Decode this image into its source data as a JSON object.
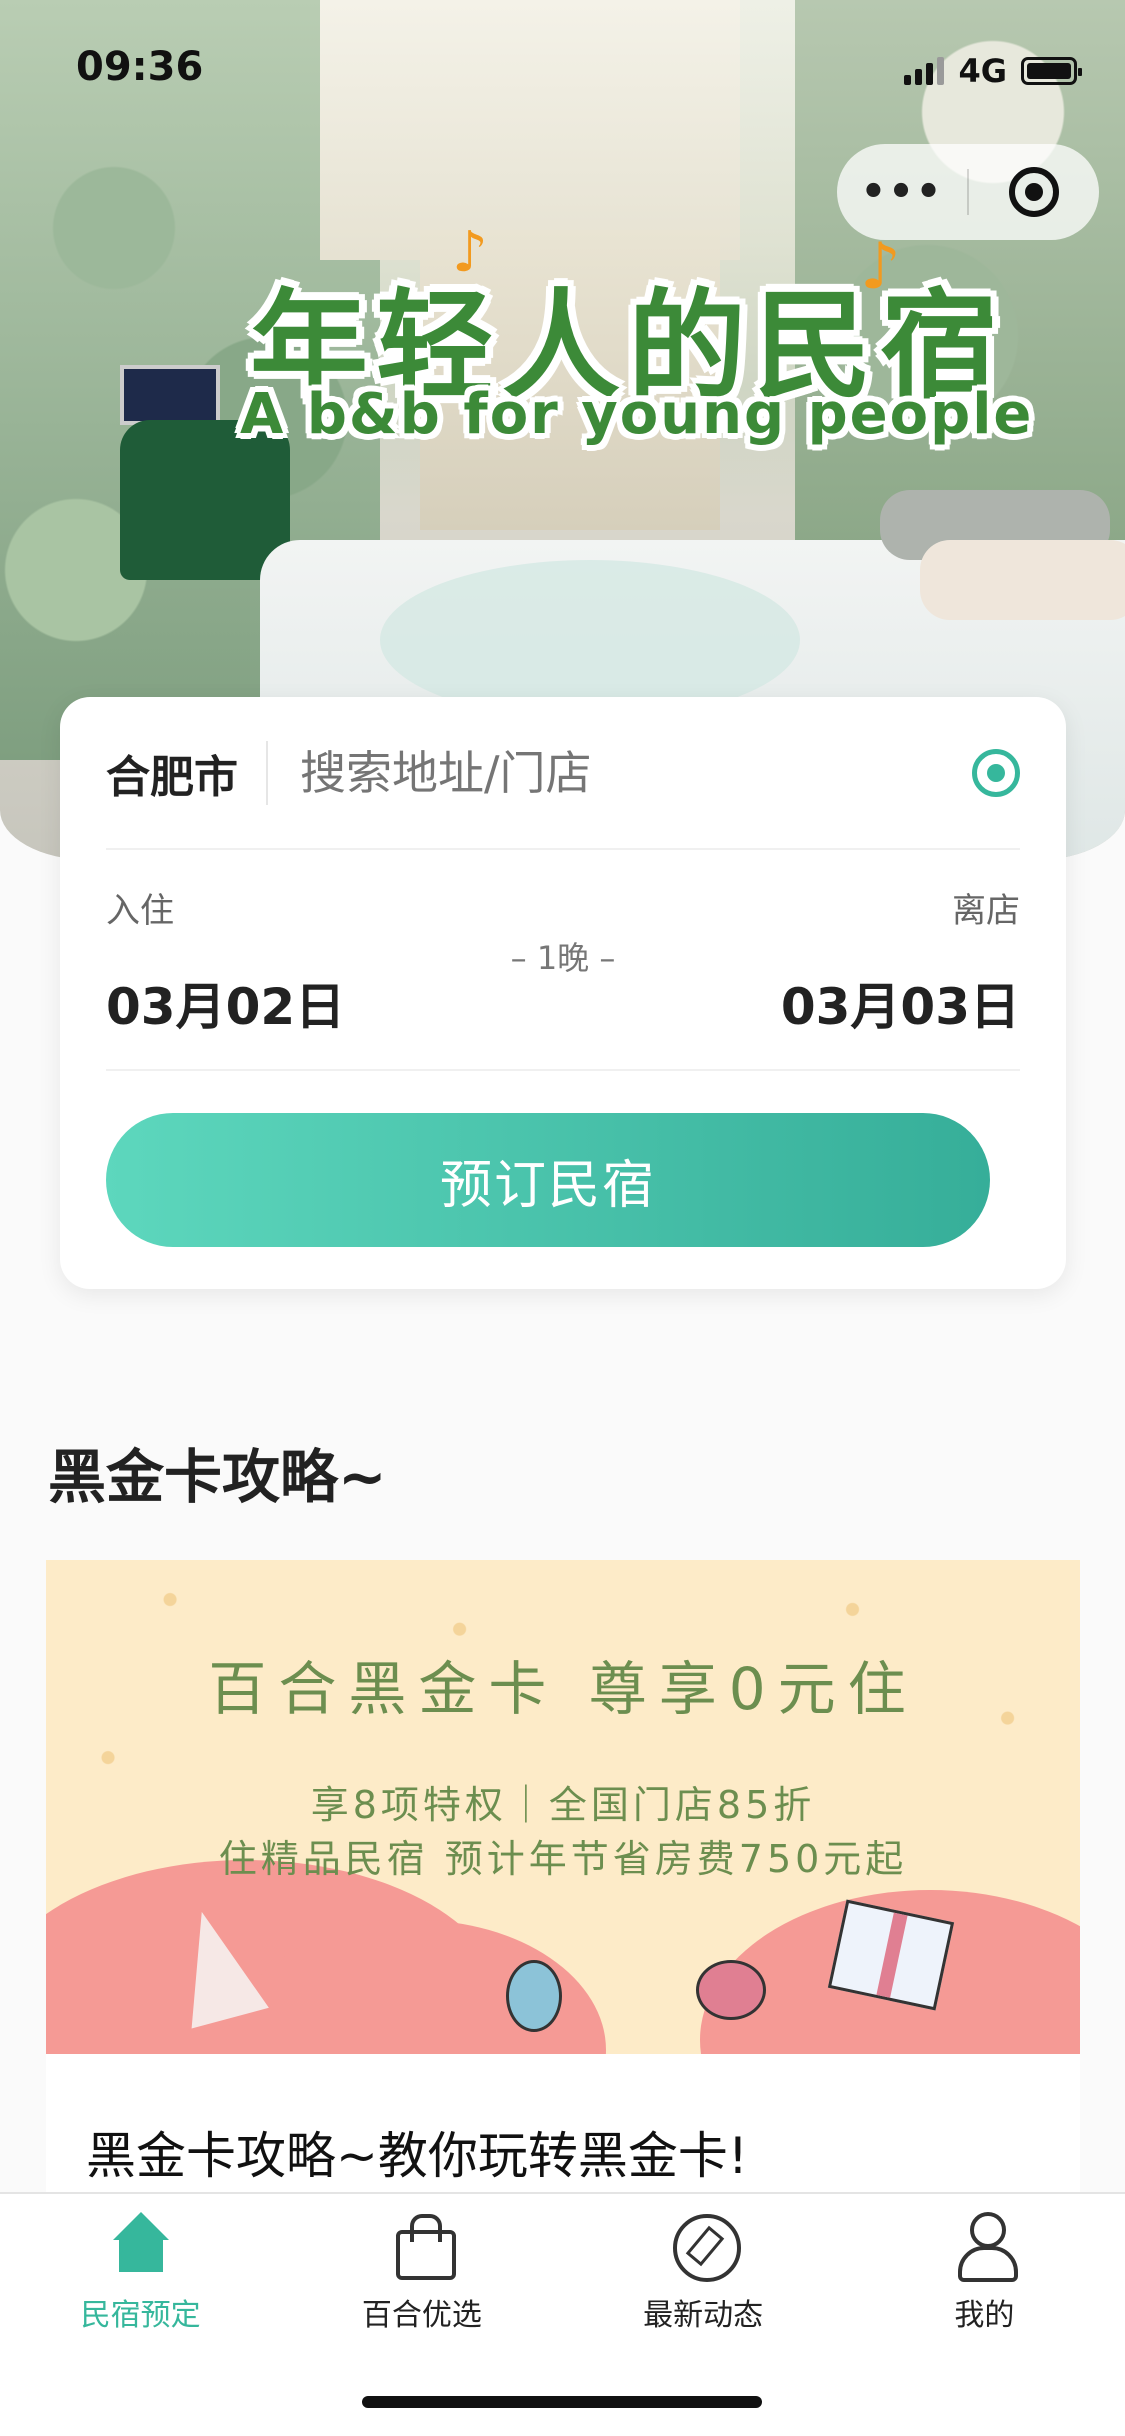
{
  "status_bar": {
    "time": "09:36",
    "network": "4G"
  },
  "capsule": {
    "more_label": "•••"
  },
  "hero": {
    "logo_cn": "年轻人的民宿",
    "logo_en": "A b&b for young people"
  },
  "booking": {
    "city": "合肥市",
    "search_placeholder": "搜索地址/门店",
    "checkin_label": "入住",
    "checkout_label": "离店",
    "nights": "– 1晚 –",
    "checkin_date": "03月02日",
    "checkout_date": "03月03日",
    "book_button": "预订民宿"
  },
  "section": {
    "title": "黑金卡攻略~",
    "banner": {
      "title": "百合黑金卡 尊享0元住",
      "line1": "享8项特权｜全国门店85折",
      "line2": "住精品民宿 预计年节省房费750元起"
    },
    "article_title": "黑金卡攻略~教你玩转黑金卡!"
  },
  "tabbar": {
    "tabs": [
      {
        "label": "民宿预定",
        "icon": "home-icon",
        "active": true
      },
      {
        "label": "百合优选",
        "icon": "bag-icon",
        "active": false
      },
      {
        "label": "最新动态",
        "icon": "compass-icon",
        "active": false
      },
      {
        "label": "我的",
        "icon": "user-icon",
        "active": false
      }
    ]
  },
  "colors": {
    "accent": "#36b79c",
    "logo_green": "#3c8a38",
    "banner_bg": "#fdebc8",
    "banner_text": "#6c8e4f",
    "cloud": "#f59a95"
  }
}
